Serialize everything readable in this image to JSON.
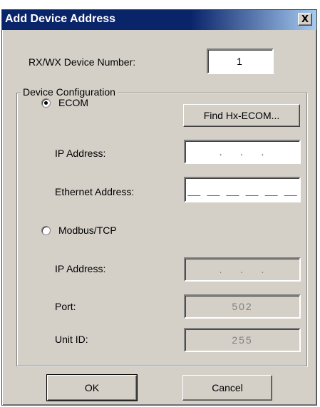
{
  "window": {
    "title": "Add Device Address",
    "close_glyph": "X"
  },
  "device_number": {
    "label": "RX/WX Device Number:",
    "value": "1"
  },
  "group": {
    "legend": "Device Configuration"
  },
  "ecom": {
    "label": "ECOM",
    "selected": true,
    "find_button": "Find Hx-ECOM...",
    "ip_label": "IP Address:",
    "ip_value": ".    .    .",
    "ethernet_label": "Ethernet Address:",
    "ethernet_value": "__ __ __ __ __ __"
  },
  "modbus": {
    "label": "Modbus/TCP",
    "selected": false,
    "ip_label": "IP Address:",
    "ip_value": ".    .    .",
    "port_label": "Port:",
    "port_value": "502",
    "unit_label": "Unit ID:",
    "unit_value": "255"
  },
  "buttons": {
    "ok": "OK",
    "cancel": "Cancel"
  },
  "colors": {
    "titlebar": "#0a246a",
    "face": "#d4d0c8"
  }
}
